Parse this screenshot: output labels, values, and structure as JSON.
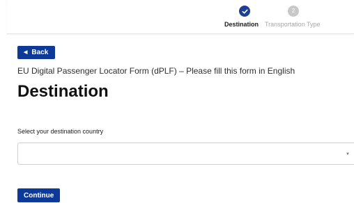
{
  "stepper": {
    "steps": [
      {
        "label": "Destination",
        "state": "completed",
        "icon": "check-icon"
      },
      {
        "label": "Transportation Type",
        "state": "upcoming",
        "number": "2"
      }
    ]
  },
  "back_button": {
    "label": "Back",
    "icon": "chevron-left-icon"
  },
  "form_subtitle": "EU Digital Passenger Locator Form (dPLF) – Please fill this form in English",
  "page_title": "Destination",
  "destination_field": {
    "label": "Select your destination country",
    "value": "",
    "icon": "dropdown-arrow-icon"
  },
  "continue_button": {
    "label": "Continue"
  },
  "colors": {
    "primary": "#0d3a99",
    "step_done": "#1f3f95",
    "step_todo": "#c8c8c8"
  }
}
